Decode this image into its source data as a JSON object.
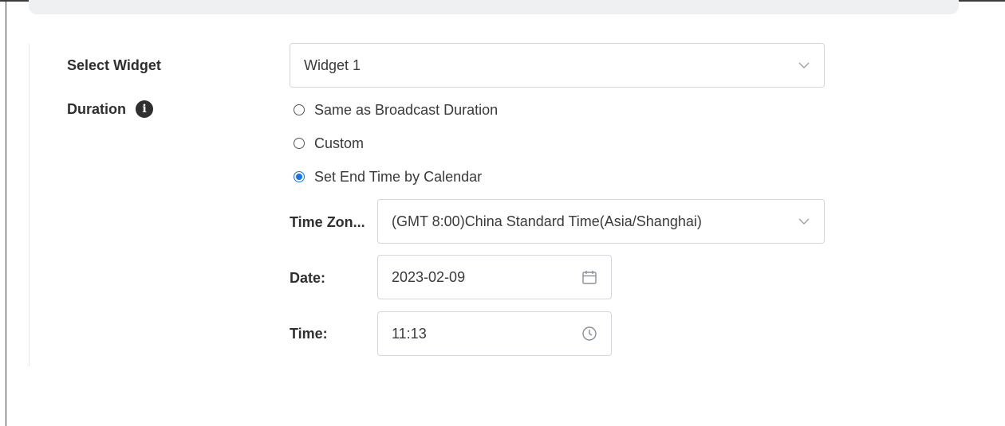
{
  "form": {
    "widget": {
      "label": "Select Widget",
      "value": "Widget 1",
      "icon": "chevron-down-icon"
    },
    "duration": {
      "label": "Duration",
      "info_icon": "i",
      "options": [
        {
          "label": "Same as Broadcast Duration",
          "checked": false
        },
        {
          "label": "Custom",
          "checked": false
        },
        {
          "label": "Set End Time by Calendar",
          "checked": true
        }
      ]
    },
    "timezone": {
      "label": "Time Zon...",
      "value": "(GMT 8:00)China Standard Time(Asia/Shanghai)",
      "icon": "chevron-down-icon"
    },
    "date": {
      "label": "Date:",
      "value": "2023-02-09",
      "icon": "calendar-icon"
    },
    "time": {
      "label": "Time:",
      "value": "11:13",
      "icon": "clock-icon"
    }
  },
  "colors": {
    "accent": "#1a73e8",
    "border": "#d3d7dc",
    "label": "#2f2f2f"
  }
}
